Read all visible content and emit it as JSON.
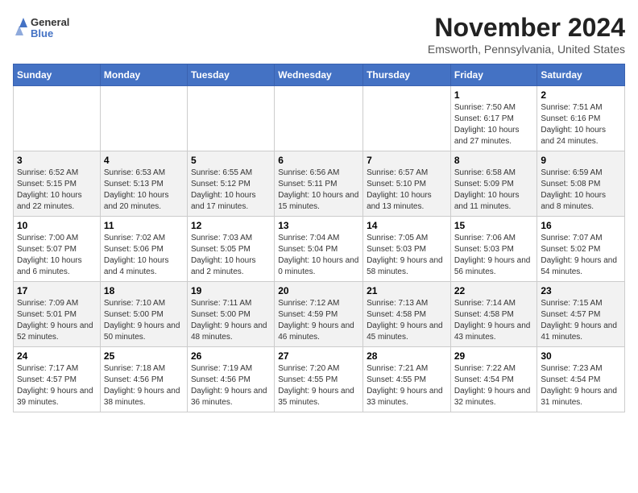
{
  "header": {
    "logo_line1": "General",
    "logo_line2": "Blue",
    "month": "November 2024",
    "location": "Emsworth, Pennsylvania, United States"
  },
  "weekdays": [
    "Sunday",
    "Monday",
    "Tuesday",
    "Wednesday",
    "Thursday",
    "Friday",
    "Saturday"
  ],
  "weeks": [
    [
      {
        "day": "",
        "info": ""
      },
      {
        "day": "",
        "info": ""
      },
      {
        "day": "",
        "info": ""
      },
      {
        "day": "",
        "info": ""
      },
      {
        "day": "",
        "info": ""
      },
      {
        "day": "1",
        "info": "Sunrise: 7:50 AM\nSunset: 6:17 PM\nDaylight: 10 hours and 27 minutes."
      },
      {
        "day": "2",
        "info": "Sunrise: 7:51 AM\nSunset: 6:16 PM\nDaylight: 10 hours and 24 minutes."
      }
    ],
    [
      {
        "day": "3",
        "info": "Sunrise: 6:52 AM\nSunset: 5:15 PM\nDaylight: 10 hours and 22 minutes."
      },
      {
        "day": "4",
        "info": "Sunrise: 6:53 AM\nSunset: 5:13 PM\nDaylight: 10 hours and 20 minutes."
      },
      {
        "day": "5",
        "info": "Sunrise: 6:55 AM\nSunset: 5:12 PM\nDaylight: 10 hours and 17 minutes."
      },
      {
        "day": "6",
        "info": "Sunrise: 6:56 AM\nSunset: 5:11 PM\nDaylight: 10 hours and 15 minutes."
      },
      {
        "day": "7",
        "info": "Sunrise: 6:57 AM\nSunset: 5:10 PM\nDaylight: 10 hours and 13 minutes."
      },
      {
        "day": "8",
        "info": "Sunrise: 6:58 AM\nSunset: 5:09 PM\nDaylight: 10 hours and 11 minutes."
      },
      {
        "day": "9",
        "info": "Sunrise: 6:59 AM\nSunset: 5:08 PM\nDaylight: 10 hours and 8 minutes."
      }
    ],
    [
      {
        "day": "10",
        "info": "Sunrise: 7:00 AM\nSunset: 5:07 PM\nDaylight: 10 hours and 6 minutes."
      },
      {
        "day": "11",
        "info": "Sunrise: 7:02 AM\nSunset: 5:06 PM\nDaylight: 10 hours and 4 minutes."
      },
      {
        "day": "12",
        "info": "Sunrise: 7:03 AM\nSunset: 5:05 PM\nDaylight: 10 hours and 2 minutes."
      },
      {
        "day": "13",
        "info": "Sunrise: 7:04 AM\nSunset: 5:04 PM\nDaylight: 10 hours and 0 minutes."
      },
      {
        "day": "14",
        "info": "Sunrise: 7:05 AM\nSunset: 5:03 PM\nDaylight: 9 hours and 58 minutes."
      },
      {
        "day": "15",
        "info": "Sunrise: 7:06 AM\nSunset: 5:03 PM\nDaylight: 9 hours and 56 minutes."
      },
      {
        "day": "16",
        "info": "Sunrise: 7:07 AM\nSunset: 5:02 PM\nDaylight: 9 hours and 54 minutes."
      }
    ],
    [
      {
        "day": "17",
        "info": "Sunrise: 7:09 AM\nSunset: 5:01 PM\nDaylight: 9 hours and 52 minutes."
      },
      {
        "day": "18",
        "info": "Sunrise: 7:10 AM\nSunset: 5:00 PM\nDaylight: 9 hours and 50 minutes."
      },
      {
        "day": "19",
        "info": "Sunrise: 7:11 AM\nSunset: 5:00 PM\nDaylight: 9 hours and 48 minutes."
      },
      {
        "day": "20",
        "info": "Sunrise: 7:12 AM\nSunset: 4:59 PM\nDaylight: 9 hours and 46 minutes."
      },
      {
        "day": "21",
        "info": "Sunrise: 7:13 AM\nSunset: 4:58 PM\nDaylight: 9 hours and 45 minutes."
      },
      {
        "day": "22",
        "info": "Sunrise: 7:14 AM\nSunset: 4:58 PM\nDaylight: 9 hours and 43 minutes."
      },
      {
        "day": "23",
        "info": "Sunrise: 7:15 AM\nSunset: 4:57 PM\nDaylight: 9 hours and 41 minutes."
      }
    ],
    [
      {
        "day": "24",
        "info": "Sunrise: 7:17 AM\nSunset: 4:57 PM\nDaylight: 9 hours and 39 minutes."
      },
      {
        "day": "25",
        "info": "Sunrise: 7:18 AM\nSunset: 4:56 PM\nDaylight: 9 hours and 38 minutes."
      },
      {
        "day": "26",
        "info": "Sunrise: 7:19 AM\nSunset: 4:56 PM\nDaylight: 9 hours and 36 minutes."
      },
      {
        "day": "27",
        "info": "Sunrise: 7:20 AM\nSunset: 4:55 PM\nDaylight: 9 hours and 35 minutes."
      },
      {
        "day": "28",
        "info": "Sunrise: 7:21 AM\nSunset: 4:55 PM\nDaylight: 9 hours and 33 minutes."
      },
      {
        "day": "29",
        "info": "Sunrise: 7:22 AM\nSunset: 4:54 PM\nDaylight: 9 hours and 32 minutes."
      },
      {
        "day": "30",
        "info": "Sunrise: 7:23 AM\nSunset: 4:54 PM\nDaylight: 9 hours and 31 minutes."
      }
    ]
  ]
}
